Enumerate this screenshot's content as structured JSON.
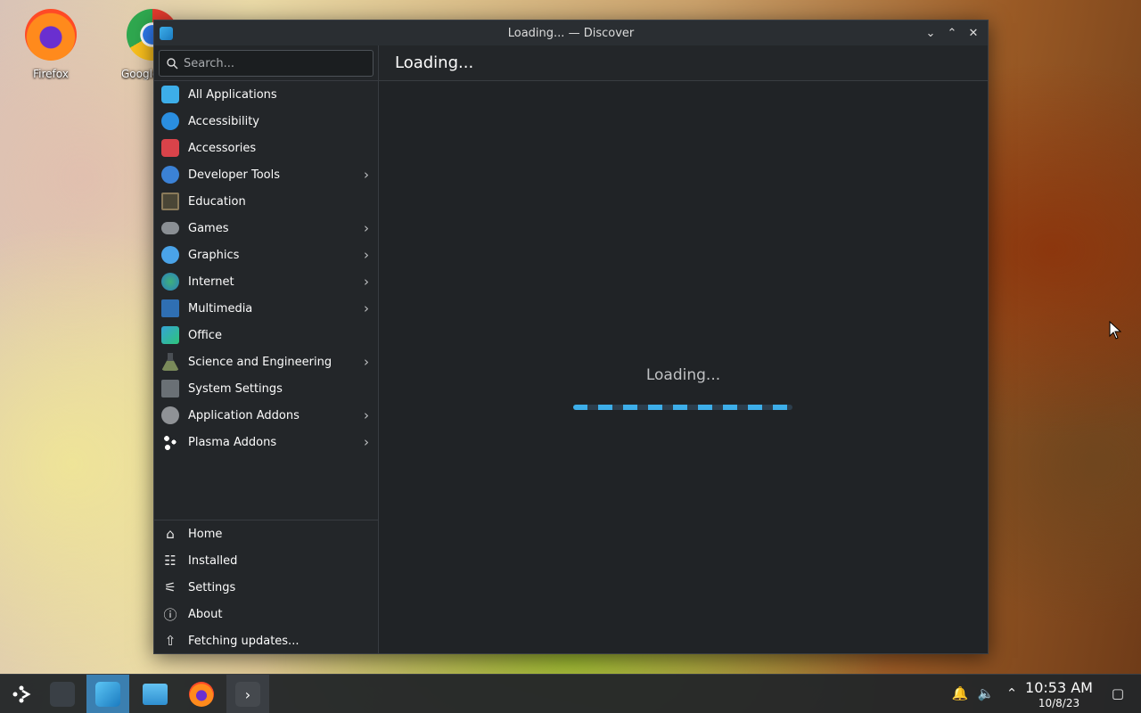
{
  "desktop": {
    "icons": [
      {
        "label": "Firefox"
      },
      {
        "label": "Google Chrome"
      }
    ]
  },
  "window": {
    "title": "Loading... — Discover",
    "controls": {
      "minimize": "⌄",
      "maximize": "⌃",
      "close": "✕"
    }
  },
  "sidebar": {
    "search_placeholder": "Search...",
    "categories": [
      {
        "label": "All Applications",
        "color": "#3daee9",
        "has_submenu": false
      },
      {
        "label": "Accessibility",
        "color": "#2a8ee0",
        "has_submenu": false
      },
      {
        "label": "Accessories",
        "color": "#d9434a",
        "has_submenu": false
      },
      {
        "label": "Developer Tools",
        "color": "#3b82d6",
        "has_submenu": true
      },
      {
        "label": "Education",
        "color": "#6e6552",
        "has_submenu": false
      },
      {
        "label": "Games",
        "color": "#8a8f94",
        "has_submenu": true
      },
      {
        "label": "Graphics",
        "color": "#4aa3e8",
        "has_submenu": true
      },
      {
        "label": "Internet",
        "color": "#3fb07a",
        "has_submenu": true
      },
      {
        "label": "Multimedia",
        "color": "#2f6fb3",
        "has_submenu": true
      },
      {
        "label": "Office",
        "color": "#35a3d6",
        "has_submenu": false
      },
      {
        "label": "Science and Engineering",
        "color": "#7a8a5a",
        "has_submenu": true
      },
      {
        "label": "System Settings",
        "color": "#6a7075",
        "has_submenu": false
      },
      {
        "label": "Application Addons",
        "color": "#8f9296",
        "has_submenu": true
      },
      {
        "label": "Plasma Addons",
        "color": "#e0e0e0",
        "has_submenu": true
      }
    ],
    "bottom": [
      {
        "label": "Home",
        "icon": "⌂"
      },
      {
        "label": "Installed",
        "icon": "☷"
      },
      {
        "label": "Settings",
        "icon": "⚟"
      },
      {
        "label": "About",
        "icon": "ⓘ"
      },
      {
        "label": "Fetching updates...",
        "icon": "⇧"
      }
    ]
  },
  "main": {
    "header": "Loading...",
    "loading_text": "Loading...",
    "progress": "indeterminate"
  },
  "taskbar": {
    "clock_time": "10:53 AM",
    "clock_date": "10/8/23"
  },
  "colors": {
    "accent": "#3daee9",
    "window_bg": "#202326",
    "sidebar_bg": "#232629"
  }
}
